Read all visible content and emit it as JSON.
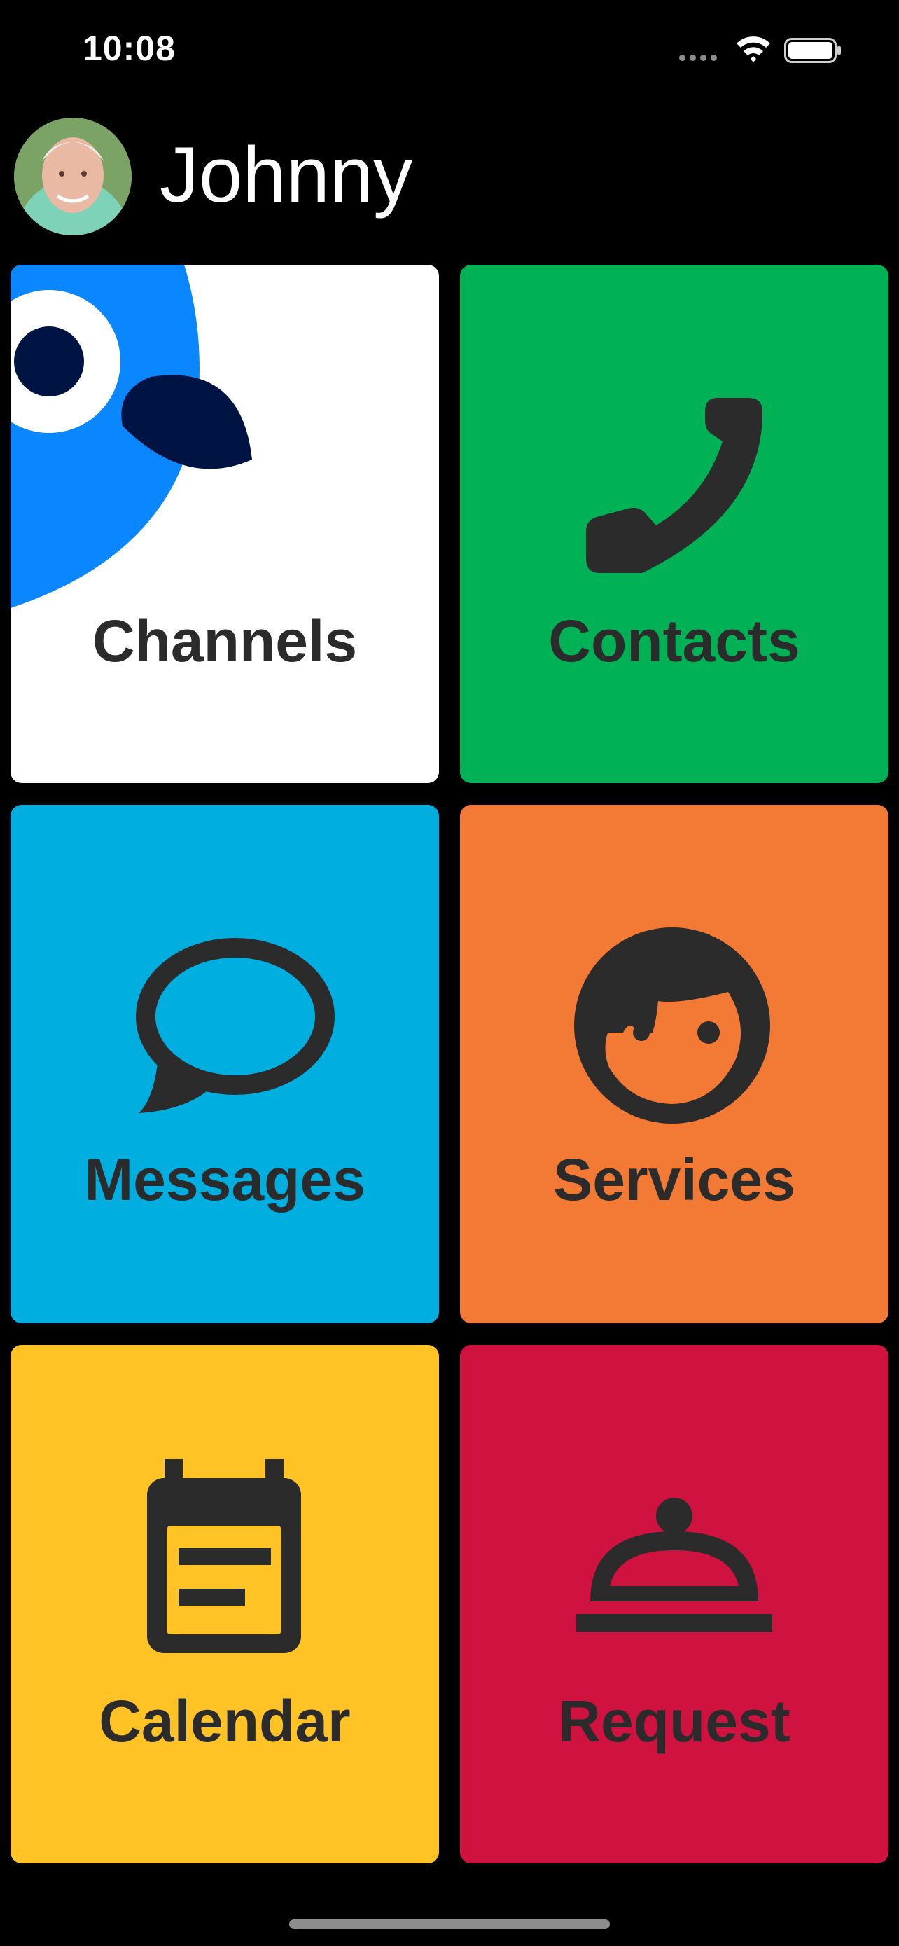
{
  "status_bar": {
    "time": "10:08"
  },
  "header": {
    "user_name": "Johnny"
  },
  "tiles": [
    {
      "label": "Channels",
      "color": "#ffffff",
      "icon": "bird-icon"
    },
    {
      "label": "Contacts",
      "color": "#00b156",
      "icon": "phone-icon"
    },
    {
      "label": "Messages",
      "color": "#00aee0",
      "icon": "speech-bubble-icon"
    },
    {
      "label": "Services",
      "color": "#f37a35",
      "icon": "face-icon"
    },
    {
      "label": "Calendar",
      "color": "#ffc325",
      "icon": "calendar-icon"
    },
    {
      "label": "Request",
      "color": "#d01240",
      "icon": "service-bell-icon"
    }
  ]
}
